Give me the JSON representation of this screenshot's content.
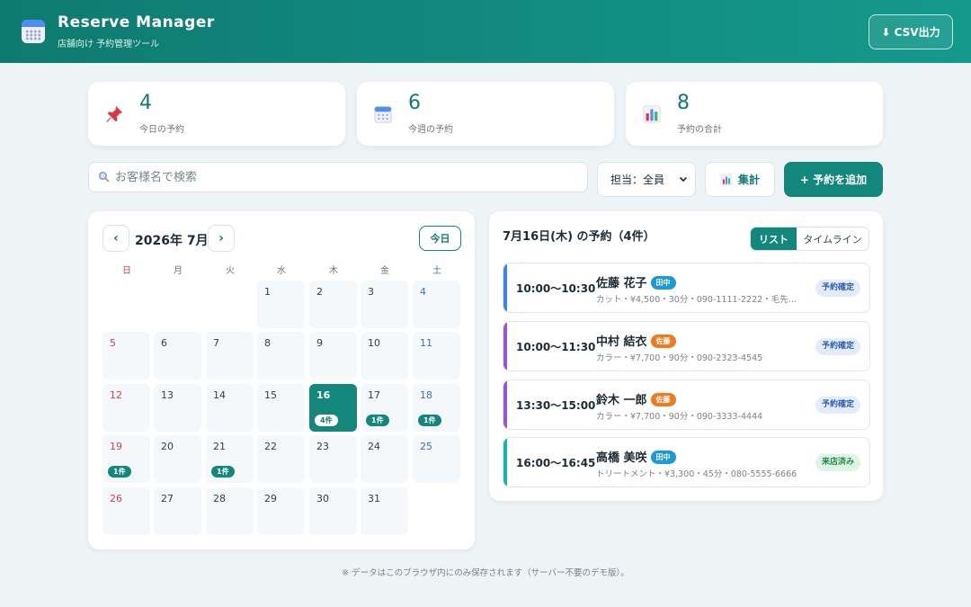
{
  "header": {
    "title": "Reserve Manager",
    "subtitle": "店舗向け 予約管理ツール",
    "csv_button": "⬇ CSV出力"
  },
  "stats": [
    {
      "icon": "pushpin-icon",
      "value": "4",
      "label": "今日の予約"
    },
    {
      "icon": "calendar-icon",
      "value": "6",
      "label": "今週の予約"
    },
    {
      "icon": "bar-chart-icon",
      "value": "8",
      "label": "予約の合計"
    }
  ],
  "toolbar": {
    "search_placeholder": "お客様名で検索",
    "search_value": "",
    "staff_select": "担当：全員",
    "stats_button": "集計",
    "add_button": "+ 予約を追加"
  },
  "calendar": {
    "prev": "‹",
    "next": "›",
    "title": "2026年 7月",
    "today_button": "今日",
    "weekdays": [
      "日",
      "月",
      "火",
      "水",
      "木",
      "金",
      "土"
    ],
    "selected_day": 16,
    "badges": {
      "16": "4件",
      "17": "1件",
      "18": "1件",
      "19": "1件",
      "21": "1件"
    }
  },
  "reservations": {
    "title": "7月16日(木) の予約（4件）",
    "view_list": "リスト",
    "view_timeline": "タイムライン",
    "items": [
      {
        "time": "10:00〜10:30",
        "name": "佐藤 花子",
        "staff": "田中",
        "staff_color": "#1a9ad6",
        "detail": "カット・¥4,500・30分・090-1111-2222・毛先…",
        "status": "予約確定",
        "status_bg": "#e3ecfb",
        "status_fg": "#2f5fb0",
        "bar_color": "#3b82f6"
      },
      {
        "time": "10:00〜11:30",
        "name": "中村 結衣",
        "staff": "佐藤",
        "staff_color": "#f07a1f",
        "detail": "カラー・¥7,700・90分・090-2323-4545",
        "status": "予約確定",
        "status_bg": "#e3ecfb",
        "status_fg": "#2f5fb0",
        "bar_color": "#9b51e0"
      },
      {
        "time": "13:30〜15:00",
        "name": "鈴木 一郎",
        "staff": "佐藤",
        "staff_color": "#f07a1f",
        "detail": "カラー・¥7,700・90分・090-3333-4444",
        "status": "予約確定",
        "status_bg": "#e3ecfb",
        "status_fg": "#2f5fb0",
        "bar_color": "#9b51e0"
      },
      {
        "time": "16:00〜16:45",
        "name": "高橋 美咲",
        "staff": "田中",
        "staff_color": "#1a9ad6",
        "detail": "トリートメント・¥3,300・45分・080-5555-6666",
        "status": "来店済み",
        "status_bg": "#def5e6",
        "status_fg": "#1f8a4c",
        "bar_color": "#14b8a6"
      }
    ]
  },
  "footer": "※ データはこのブラウザ内にのみ保存されます（サーバー不要のデモ版）。"
}
